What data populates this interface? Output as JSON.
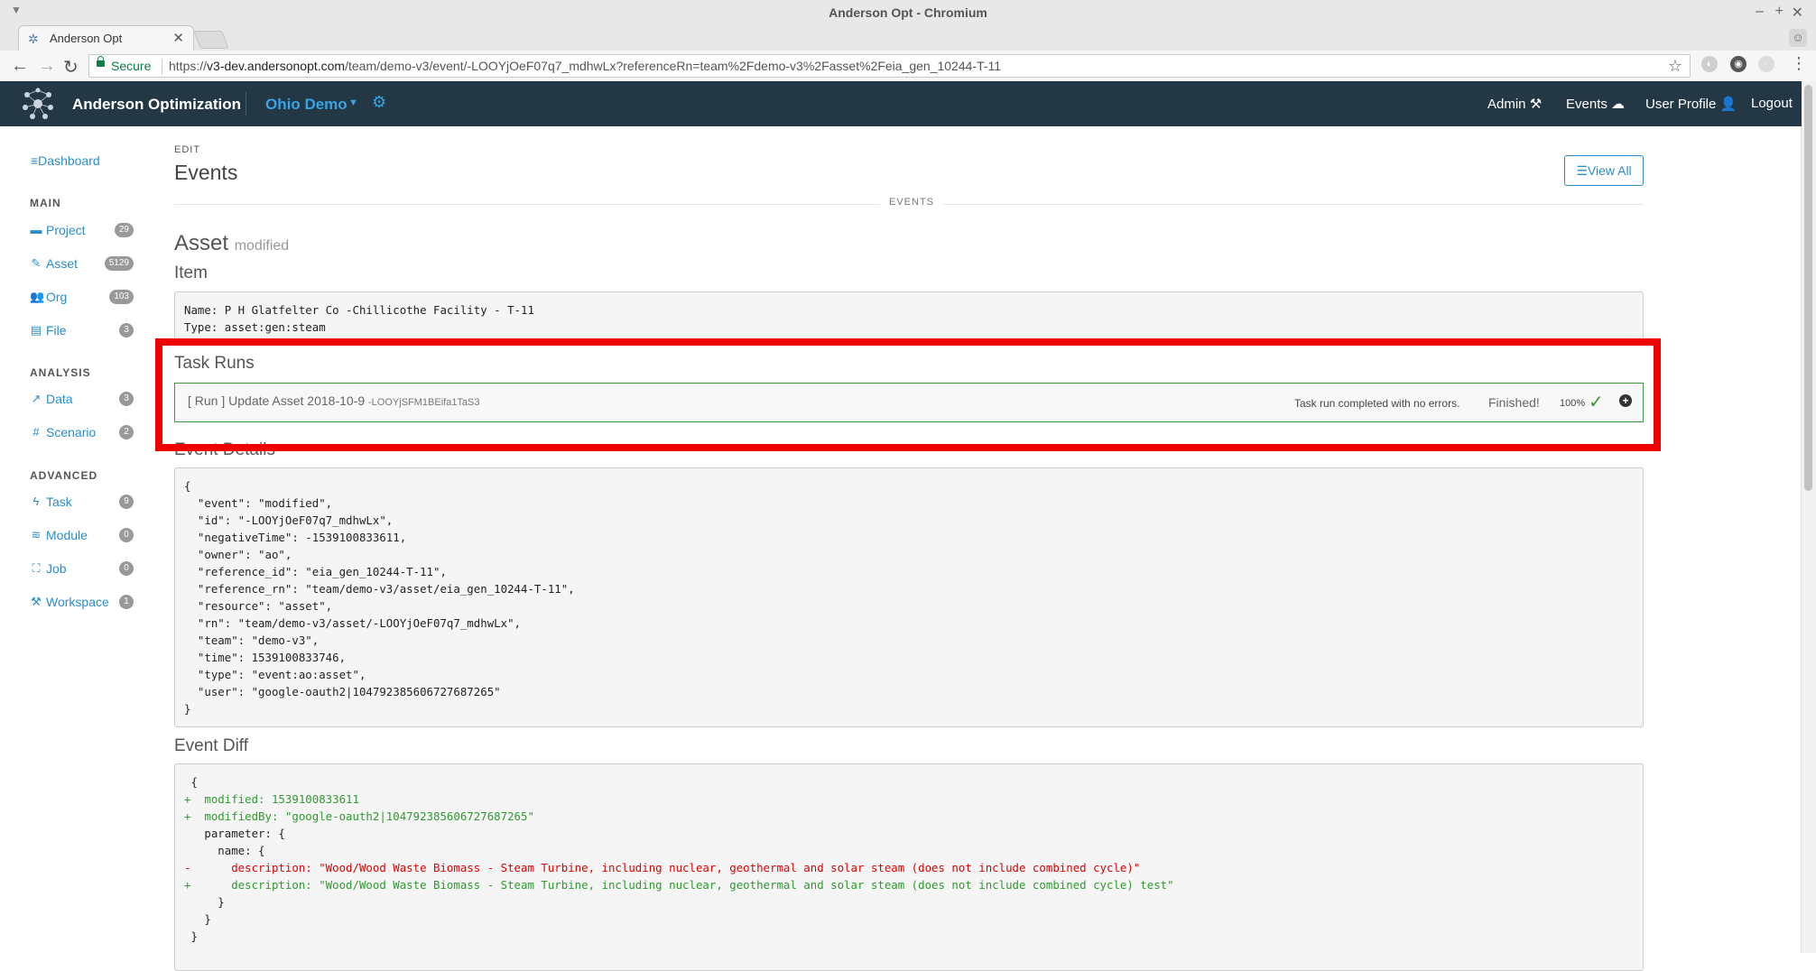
{
  "window": {
    "title": "Anderson Opt - Chromium",
    "tab_title": "Anderson Opt",
    "secure_label": "Secure",
    "url_scheme": "https://",
    "url_host": "v3-dev.andersonopt.com",
    "url_path": "/team/demo-v3/event/-LOOYjOeF07q7_mdhwLx?referenceRn=team%2Fdemo-v3%2Fasset%2Feia_gen_10244-T-11"
  },
  "navbar": {
    "brand": "Anderson Optimization",
    "team": "Ohio Demo",
    "links": [
      "Admin",
      "Events",
      "User Profile",
      "Logout"
    ],
    "accent": "#3aa3e3",
    "background": "#243745"
  },
  "sidebar": {
    "dashboard": "Dashboard",
    "sections": [
      {
        "label": "MAIN",
        "items": [
          {
            "label": "Project",
            "count": "29",
            "icon": "folder-icon"
          },
          {
            "label": "Asset",
            "count": "5129",
            "icon": "pencil-icon"
          },
          {
            "label": "Org",
            "count": "103",
            "icon": "users-icon"
          },
          {
            "label": "File",
            "count": "3",
            "icon": "file-icon"
          }
        ]
      },
      {
        "label": "ANALYSIS",
        "items": [
          {
            "label": "Data",
            "count": "3",
            "icon": "chart-line-icon"
          },
          {
            "label": "Scenario",
            "count": "2",
            "icon": "grid-icon"
          }
        ]
      },
      {
        "label": "ADVANCED",
        "items": [
          {
            "label": "Task",
            "count": "9",
            "icon": "bolt-icon"
          },
          {
            "label": "Module",
            "count": "0",
            "icon": "database-icon"
          },
          {
            "label": "Job",
            "count": "0",
            "icon": "sitemap-icon"
          },
          {
            "label": "Workspace",
            "count": "1",
            "icon": "tools-icon"
          }
        ]
      }
    ]
  },
  "main": {
    "edit_label": "EDIT",
    "title": "Events",
    "view_all": "View All",
    "divider_label": "EVENTS",
    "asset_heading": "Asset",
    "asset_sub": "modified",
    "item_title": "Item",
    "item_lines": [
      "Name: P H Glatfelter Co -Chillicothe Facility - T-11",
      "Type: asset:gen:steam"
    ],
    "task_runs_title": "Task Runs",
    "task_run": {
      "title": "[ Run ] Update Asset 2018-10-9",
      "id": "-LOOYjSFM1BEifa1TaS3",
      "message": "Task run completed with no errors.",
      "status": "Finished!",
      "percent": "100%"
    },
    "event_details_title": "Event Details",
    "event_details_lines": [
      "{",
      "  \"event\": \"modified\",",
      "  \"id\": \"-LOOYjOeF07q7_mdhwLx\",",
      "  \"negativeTime\": -1539100833611,",
      "  \"owner\": \"ao\",",
      "  \"reference_id\": \"eia_gen_10244-T-11\",",
      "  \"reference_rn\": \"team/demo-v3/asset/eia_gen_10244-T-11\",",
      "  \"resource\": \"asset\",",
      "  \"rn\": \"team/demo-v3/asset/-LOOYjOeF07q7_mdhwLx\",",
      "  \"team\": \"demo-v3\",",
      "  \"time\": 1539100833746,",
      "  \"type\": \"event:ao:asset\",",
      "  \"user\": \"google-oauth2|104792385606727687265\"",
      "}"
    ],
    "event_diff_title": "Event Diff",
    "event_diff_lines": [
      {
        "kind": "ctx",
        "text": " {"
      },
      {
        "kind": "add",
        "text": "+  modified: 1539100833611"
      },
      {
        "kind": "add",
        "text": "+  modifiedBy: \"google-oauth2|104792385606727687265\""
      },
      {
        "kind": "ctx",
        "text": "   parameter: {"
      },
      {
        "kind": "ctx",
        "text": "     name: {"
      },
      {
        "kind": "del",
        "text": "-      description: \"Wood/Wood Waste Biomass - Steam Turbine, including nuclear, geothermal and solar steam (does not include combined cycle)\""
      },
      {
        "kind": "add",
        "text": "+      description: \"Wood/Wood Waste Biomass - Steam Turbine, including nuclear, geothermal and solar steam (does not include combined cycle) test\""
      },
      {
        "kind": "ctx",
        "text": "     }"
      },
      {
        "kind": "ctx",
        "text": "   }"
      },
      {
        "kind": "ctx",
        "text": " }"
      }
    ]
  },
  "colors": {
    "highlight": "#ee0000",
    "success": "#3c9b3c",
    "link": "#2a8dcc"
  }
}
